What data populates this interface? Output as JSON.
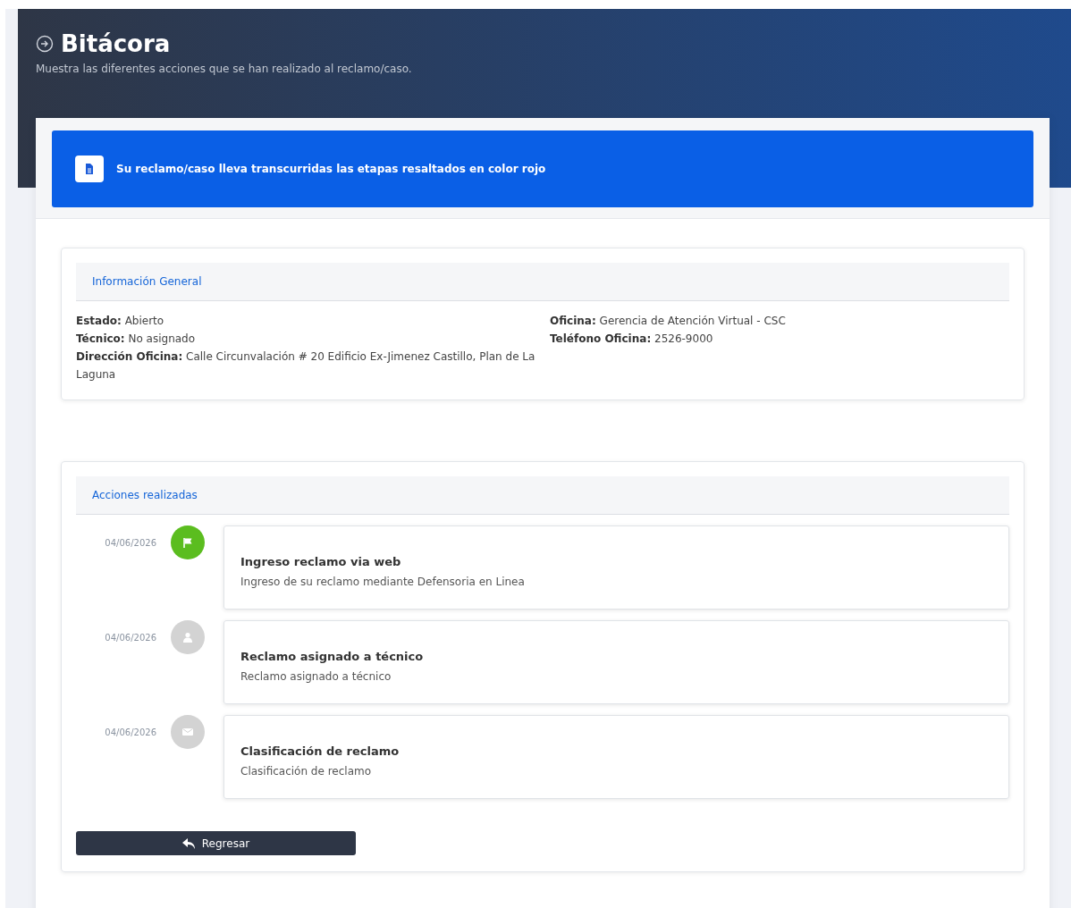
{
  "header": {
    "title": "Bitácora",
    "subtitle": "Muestra las diferentes acciones que se han realizado al reclamo/caso."
  },
  "alert": {
    "text": "Su reclamo/caso lleva transcurridas las etapas resaltados en color rojo"
  },
  "general": {
    "title": "Información General",
    "left": [
      {
        "label": "Estado:",
        "value": "Abierto"
      },
      {
        "label": "Técnico:",
        "value": "No asignado"
      },
      {
        "label": "Dirección Oficina:",
        "value": "Calle Circunvalación # 20 Edificio Ex-Jimenez Castillo, Plan de La Laguna"
      }
    ],
    "right": [
      {
        "label": "Oficina:",
        "value": "Gerencia de Atención Virtual - CSC"
      },
      {
        "label": "Teléfono Oficina:",
        "value": "2526-9000"
      }
    ]
  },
  "actions": {
    "title": "Acciones realizadas",
    "items": [
      {
        "date": "04/06/2026",
        "kind": "flag",
        "completed": true,
        "title": "Ingreso reclamo via web",
        "description": "Ingreso de su reclamo mediante Defensoria en Linea"
      },
      {
        "date": "04/06/2026",
        "kind": "user",
        "completed": false,
        "title": "Reclamo asignado a técnico",
        "description": "Reclamo asignado a técnico"
      },
      {
        "date": "04/06/2026",
        "kind": "mail",
        "completed": false,
        "title": "Clasificación de reclamo",
        "description": "Clasificación de reclamo"
      }
    ]
  },
  "back_button": {
    "label": "Regresar"
  }
}
